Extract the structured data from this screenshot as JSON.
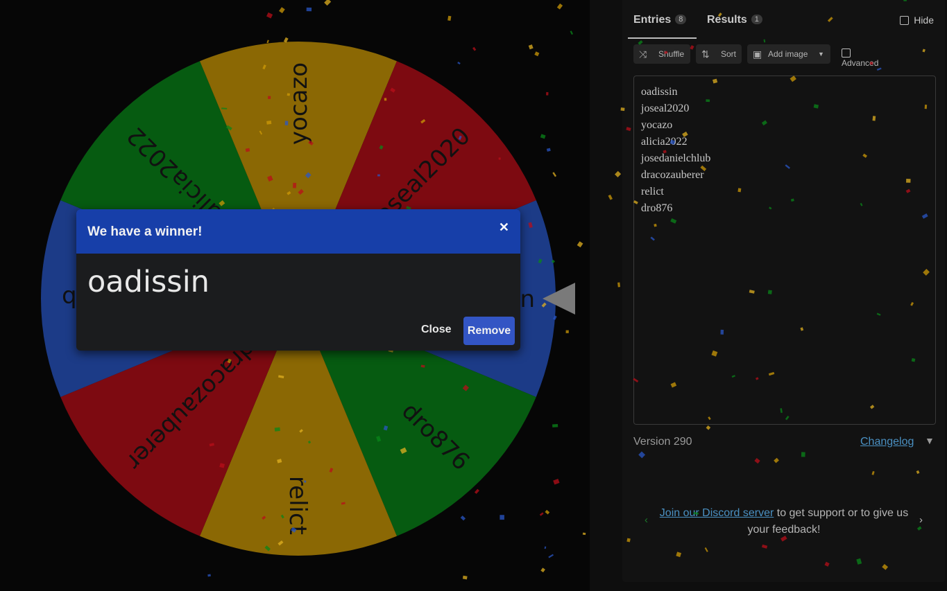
{
  "wheel": {
    "segments": [
      {
        "label": "oadissin",
        "color": "#2a57c7"
      },
      {
        "label": "dro876",
        "color": "#09861a"
      },
      {
        "label": "relict",
        "color": "#cd9a07"
      },
      {
        "label": "dracozauberer",
        "color": "#b80f1a"
      },
      {
        "label": "josedanielchlub",
        "color": "#2a57c7"
      },
      {
        "label": "alicia2022",
        "color": "#09861a"
      },
      {
        "label": "yocazo",
        "color": "#cd9a07"
      },
      {
        "label": "joseal2020",
        "color": "#b80f1a"
      }
    ]
  },
  "tabs": {
    "entries_label": "Entries",
    "entries_count": "8",
    "results_label": "Results",
    "results_count": "1"
  },
  "hide_label": "Hide",
  "toolbar": {
    "shuffle_label": "Shuffle",
    "sort_label": "Sort",
    "add_image_label": "Add image",
    "advanced_label": "Advanced"
  },
  "entries": [
    "oadissin",
    "joseal2020",
    "yocazo",
    "alicia2022",
    "josedanielchlub",
    "dracozauberer",
    "relict",
    "dro876"
  ],
  "version_text": "Version 290",
  "changelog_label": "Changelog",
  "discord": {
    "link_text": "Join our Discord server",
    "rest_text": " to get support or to give us your feedback!"
  },
  "modal": {
    "title": "We have a winner!",
    "winner": "oadissin",
    "close_label": "Close",
    "remove_label": "Remove"
  },
  "icons": {
    "shuffle": "shuffle-icon",
    "sort": "sort-icon",
    "image": "image-icon",
    "close": "close-icon",
    "chevron": "chevron-down-icon"
  }
}
